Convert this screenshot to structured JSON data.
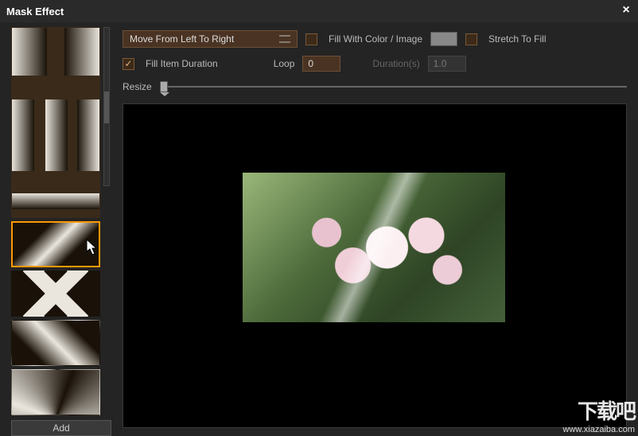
{
  "titlebar": {
    "title": "Mask Effect",
    "close": "×"
  },
  "sidebar": {
    "add_label": "Add",
    "selected_index": 4
  },
  "controls": {
    "movement": {
      "selected": "Move From Left To Right"
    },
    "fill_with_color": {
      "label": "Fill With Color / Image",
      "checked": false
    },
    "stretch_to_fill": {
      "label": "Stretch To Fill",
      "checked": false
    },
    "fill_item_duration": {
      "label": "Fill Item Duration",
      "checked": true
    },
    "loop": {
      "label": "Loop",
      "value": "0"
    },
    "duration": {
      "label": "Duration(s)",
      "value": "1.0",
      "enabled": false
    },
    "resize": {
      "label": "Resize",
      "value": 0
    }
  },
  "watermark": {
    "big": "下载吧",
    "small": "www.xiazaiba.com"
  }
}
